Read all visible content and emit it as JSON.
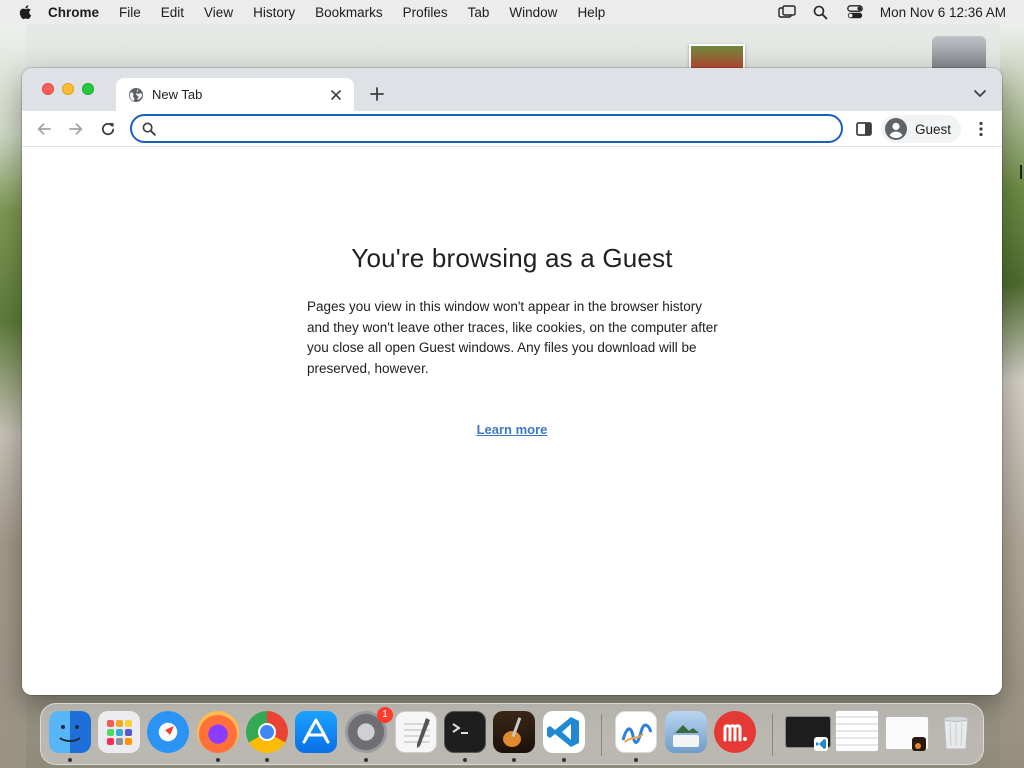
{
  "menubar": {
    "app_name": "Chrome",
    "items": [
      "File",
      "Edit",
      "View",
      "History",
      "Bookmarks",
      "Profiles",
      "Tab",
      "Window",
      "Help"
    ],
    "clock": "Mon Nov 6  12:36 AM",
    "status_icons": [
      "screen-mirroring-icon",
      "spotlight-search-icon",
      "control-center-icon"
    ]
  },
  "browser": {
    "tab": {
      "title": "New Tab",
      "icon": "globe-icon"
    },
    "omnibox": {
      "value": "",
      "placeholder": ""
    },
    "profile": {
      "label": "Guest"
    }
  },
  "page": {
    "title": "You're browsing as a Guest",
    "description": "Pages you view in this window won't appear in the browser history and they won't leave other traces, like cookies, on the computer after you close all open Guest windows. Any files you download will be preserved, however.",
    "learn_more": "Learn more"
  },
  "dock": {
    "apps": [
      {
        "name": "finder",
        "running": true,
        "color": "#2f8fe8"
      },
      {
        "name": "launchpad",
        "running": false,
        "color": "#e8e8ec"
      },
      {
        "name": "safari",
        "running": false,
        "color": "#2b9af3"
      },
      {
        "name": "firefox",
        "running": true,
        "color": "#2a1f6b"
      },
      {
        "name": "chrome",
        "running": true,
        "color": "#ffffff"
      },
      {
        "name": "app-store",
        "running": false,
        "color": "#1f8af2"
      },
      {
        "name": "system-settings",
        "running": true,
        "color": "#8e8e93",
        "badge": "1"
      },
      {
        "name": "textedit",
        "running": false,
        "color": "#f4f4f4"
      },
      {
        "name": "terminal",
        "running": true,
        "color": "#1e1e1e"
      },
      {
        "name": "garageband",
        "running": true,
        "color": "#c86a1a"
      },
      {
        "name": "vscode",
        "running": true,
        "color": "#ffffff"
      },
      {
        "name": "freeform",
        "running": true,
        "color": "#ffffff"
      },
      {
        "name": "preview",
        "running": false,
        "color": "#dfe7ef"
      },
      {
        "name": "mango-app",
        "running": false,
        "color": "#e53935"
      }
    ],
    "recent_windows": [
      "terminal-vscode-window",
      "finder-window",
      "document-window"
    ]
  }
}
